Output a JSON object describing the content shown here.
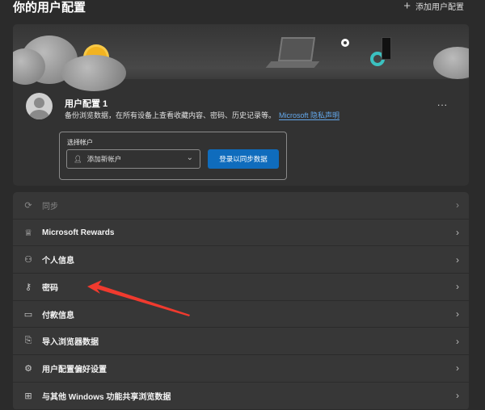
{
  "header": {
    "title": "你的用户配置",
    "add_profile": "添加用户配置"
  },
  "profile": {
    "name": "用户配置 1",
    "description": "备份浏览数据，在所有设备上查看收藏内容、密码、历史记录等。",
    "privacy_link": "Microsoft 隐私声明",
    "more": "...",
    "account_label": "选择帐户",
    "account_select": "添加新帐户",
    "sign_in_button": "登录以同步数据"
  },
  "items": [
    {
      "label": "同步",
      "icon": "sync-icon",
      "disabled": true
    },
    {
      "label": "Microsoft Rewards",
      "icon": "trophy-icon"
    },
    {
      "label": "个人信息",
      "icon": "person-card-icon"
    },
    {
      "label": "密码",
      "icon": "key-icon"
    },
    {
      "label": "付款信息",
      "icon": "credit-card-icon"
    },
    {
      "label": "导入浏览器数据",
      "icon": "import-icon"
    },
    {
      "label": "用户配置偏好设置",
      "icon": "profile-settings-icon"
    },
    {
      "label": "与其他 Windows 功能共享浏览数据",
      "icon": "windows-icon"
    }
  ],
  "colors": {
    "accent": "#0f6cbd",
    "link": "#63a8ec",
    "annotation": "#f03a2e"
  }
}
